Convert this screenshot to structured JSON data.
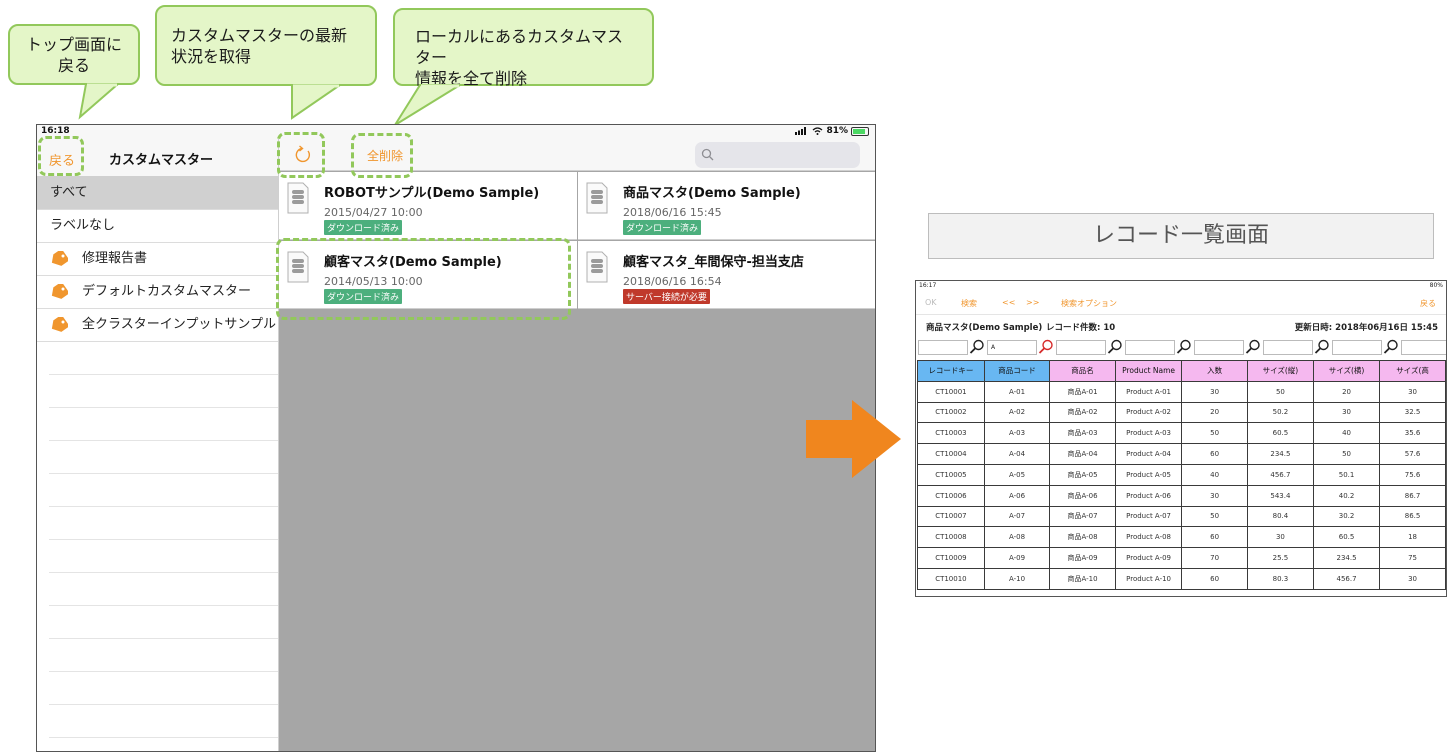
{
  "callouts": {
    "back": "トップ画面に\n戻る",
    "refresh": "カスタムマスターの最新\n状況を取得",
    "delete_all": "ローカルにあるカスタムマスター\n情報を全て削除"
  },
  "status_bar": {
    "time": "16:18",
    "battery": "81%"
  },
  "sidebar": {
    "back_label": "戻る",
    "title": "カスタムマスター",
    "items": [
      {
        "label": "すべて",
        "selected": true
      },
      {
        "label": "ラベルなし"
      },
      {
        "label": "修理報告書",
        "icon": "tag-icon"
      },
      {
        "label": "デフォルトカスタムマスター",
        "icon": "tag-icon"
      },
      {
        "label": "全クラスターインプットサンプル",
        "icon": "tag-icon"
      }
    ]
  },
  "toolbar": {
    "refresh_icon": "refresh-icon",
    "delete_label": "全削除",
    "search_placeholder": ""
  },
  "masters": [
    {
      "name": "ROBOTサンプル(Demo Sample)",
      "date": "2015/04/27 10:00",
      "status": "ダウンロード済み",
      "status_color": "#4caf7d"
    },
    {
      "name": "商品マスタ(Demo Sample)",
      "date": "2018/06/16 15:45",
      "status": "ダウンロード済み",
      "status_color": "#4caf7d"
    },
    {
      "name": "顧客マスタ(Demo Sample)",
      "date": "2014/05/13 10:00",
      "status": "ダウンロード済み",
      "status_color": "#4caf7d"
    },
    {
      "name": "顧客マスタ_年間保守-担当支店",
      "date": "2018/06/16 16:54",
      "status": "サーバー接続が必要",
      "status_color": "#c0392b"
    }
  ],
  "caption": "レコード一覧画面",
  "records_screen": {
    "time": "16:17",
    "battery": "80%",
    "toolbar": {
      "ok": "OK",
      "search": "検索",
      "prev": "<<",
      "next": ">>",
      "options": "検索オプション",
      "back": "戻る"
    },
    "master_name": "商品マスタ(Demo Sample)",
    "record_count": "レコード件数: 10",
    "updated": "更新日時: 2018年06月16日 15:45",
    "filters": [
      "",
      "A",
      "",
      "",
      "",
      "",
      "",
      ""
    ],
    "columns": [
      "レコードキー",
      "商品コード",
      "商品名",
      "Product Name",
      "入数",
      "サイズ(縦)",
      "サイズ(横)",
      "サイズ(高"
    ],
    "rows": [
      [
        "CT10001",
        "A-01",
        "商品A-01",
        "Product A-01",
        "30",
        "50",
        "20",
        "30"
      ],
      [
        "CT10002",
        "A-02",
        "商品A-02",
        "Product A-02",
        "20",
        "50.2",
        "30",
        "32.5"
      ],
      [
        "CT10003",
        "A-03",
        "商品A-03",
        "Product A-03",
        "50",
        "60.5",
        "40",
        "35.6"
      ],
      [
        "CT10004",
        "A-04",
        "商品A-04",
        "Product A-04",
        "60",
        "234.5",
        "50",
        "57.6"
      ],
      [
        "CT10005",
        "A-05",
        "商品A-05",
        "Product A-05",
        "40",
        "456.7",
        "50.1",
        "75.6"
      ],
      [
        "CT10006",
        "A-06",
        "商品A-06",
        "Product A-06",
        "30",
        "543.4",
        "40.2",
        "86.7"
      ],
      [
        "CT10007",
        "A-07",
        "商品A-07",
        "Product A-07",
        "50",
        "80.4",
        "30.2",
        "86.5"
      ],
      [
        "CT10008",
        "A-08",
        "商品A-08",
        "Product A-08",
        "60",
        "30",
        "60.5",
        "18"
      ],
      [
        "CT10009",
        "A-09",
        "商品A-09",
        "Product A-09",
        "70",
        "25.5",
        "234.5",
        "75"
      ],
      [
        "CT10010",
        "A-10",
        "商品A-10",
        "Product A-10",
        "60",
        "80.3",
        "456.7",
        "30"
      ]
    ]
  },
  "colors": {
    "accent": "#f0962e",
    "callout_fill": "#e4f6c8",
    "callout_border": "#92c85b",
    "arrow": "#f0861e"
  }
}
